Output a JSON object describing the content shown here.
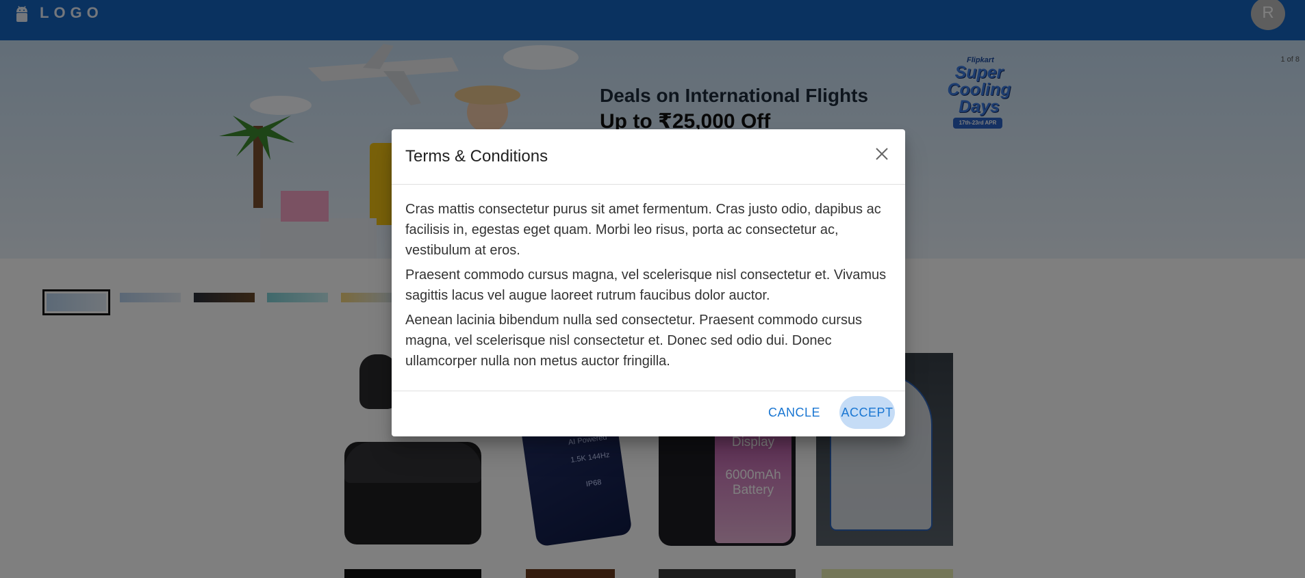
{
  "header": {
    "logo_icon": "android-robot-icon",
    "logo_text": "LOGO",
    "avatar_letter": "R"
  },
  "carousel": {
    "counter": "1 of 8",
    "slide_title": "Deals on International Flights",
    "slide_subtitle": "Up to ₹25,000 Off",
    "brand_top": "Flipkart",
    "brand_main": "Super Cooling Days",
    "brand_dates": "17th-23rd APR"
  },
  "products": {
    "phone1_text": [
      "AI Powered",
      "1.5K 144Hz",
      "IP68"
    ],
    "phone2_text": [
      "Display",
      "6000mAh",
      "Battery"
    ]
  },
  "dialog": {
    "title": "Terms & Conditions",
    "close_icon": "close-icon",
    "paragraphs": [
      "Cras mattis consectetur purus sit amet fermentum. Cras justo odio, dapibus ac facilisis in, egestas eget quam. Morbi leo risus, porta ac consectetur ac, vestibulum at eros.",
      "Praesent commodo cursus magna, vel scelerisque nisl consectetur et. Vivamus sagittis lacus vel augue laoreet rutrum faucibus dolor auctor.",
      "Aenean lacinia bibendum nulla sed consectetur. Praesent commodo cursus magna, vel scelerisque nisl consectetur et. Donec sed odio dui. Donec ullamcorper nulla non metus auctor fringilla."
    ],
    "cancel_label": "CANCLE",
    "accept_label": "ACCEPT"
  },
  "colors": {
    "appbar": "#1565c0",
    "primary": "#1976d2",
    "accept_highlight": "#c5dcf6"
  }
}
